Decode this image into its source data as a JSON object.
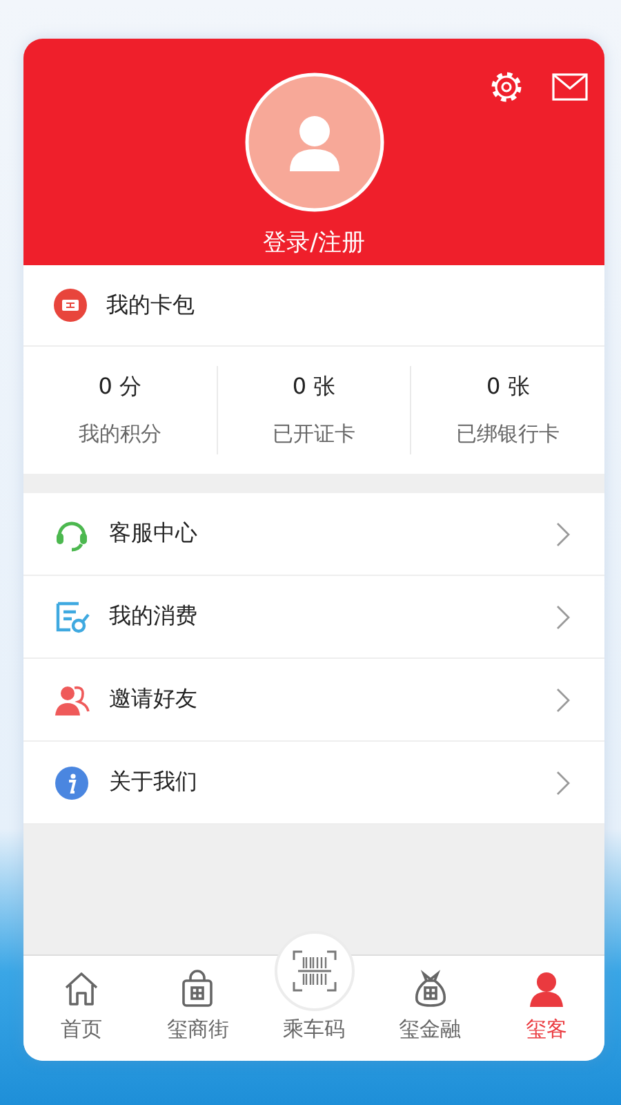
{
  "header": {
    "login_label": "登录/注册"
  },
  "wallet": {
    "label": "我的卡包"
  },
  "stats": [
    {
      "value": "0 分",
      "label": "我的积分"
    },
    {
      "value": "0 张",
      "label": "已开证卡"
    },
    {
      "value": "0 张",
      "label": "已绑银行卡"
    }
  ],
  "menu": [
    {
      "kind": "service",
      "label": "客服中心"
    },
    {
      "kind": "spending",
      "label": "我的消费"
    },
    {
      "kind": "invite",
      "label": "邀请好友"
    },
    {
      "kind": "about",
      "label": "关于我们"
    }
  ],
  "tab_bar": [
    {
      "kind": "home",
      "label": "首页",
      "selected": false
    },
    {
      "kind": "shop",
      "label": "玺商街",
      "selected": false
    },
    {
      "kind": "scan",
      "label": "乘车码",
      "selected": false
    },
    {
      "kind": "finance",
      "label": "玺金融",
      "selected": false
    },
    {
      "kind": "profile",
      "label": "玺客",
      "selected": true
    }
  ]
}
